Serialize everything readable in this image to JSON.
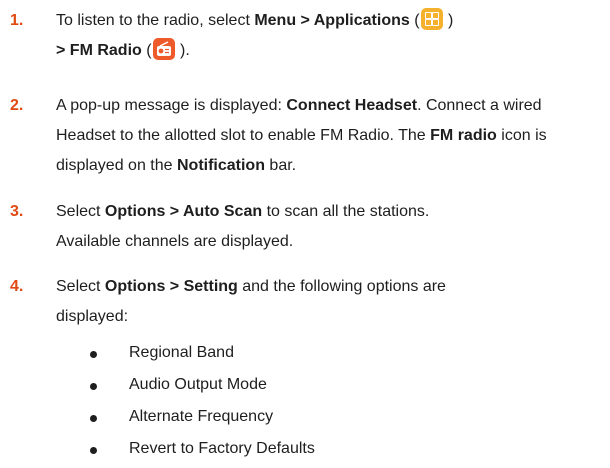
{
  "steps": [
    {
      "number": "1.",
      "line1": {
        "pre": "To listen to the radio, select ",
        "menu": "Menu",
        "gt": " > ",
        "apps": "Applications",
        "open": " (",
        "close": " )"
      },
      "line2": {
        "gt": "> ",
        "fm": "FM Radio",
        "open": " (",
        "close": " )."
      }
    },
    {
      "number": "2.",
      "t1": "A pop-up message is displayed: ",
      "t2": "Connect Headset",
      "t3": ". Connect a wired Headset to the allotted slot to enable FM Radio. The ",
      "t4": "FM radio",
      "t5": " icon is displayed on the ",
      "t6": "Notification",
      "t7": " bar."
    },
    {
      "number": "3.",
      "t1": "Select ",
      "t2": "Options > Auto Scan",
      "t3": " to scan all the stations. Available channels are displayed."
    },
    {
      "number": "4.",
      "t1": "Select ",
      "t2": "Options > Setting",
      "t3": " and the following options are displayed:",
      "options": [
        "Regional Band",
        "Audio Output Mode",
        "Alternate Frequency",
        "Revert to Factory Defaults"
      ]
    }
  ],
  "icons": {
    "applications": "apps-grid-icon",
    "fm_radio": "fm-radio-icon"
  },
  "colors": {
    "step_number": "#e04a12",
    "apps_icon": "#f6b12c",
    "radio_icon": "#ee5a2a"
  }
}
